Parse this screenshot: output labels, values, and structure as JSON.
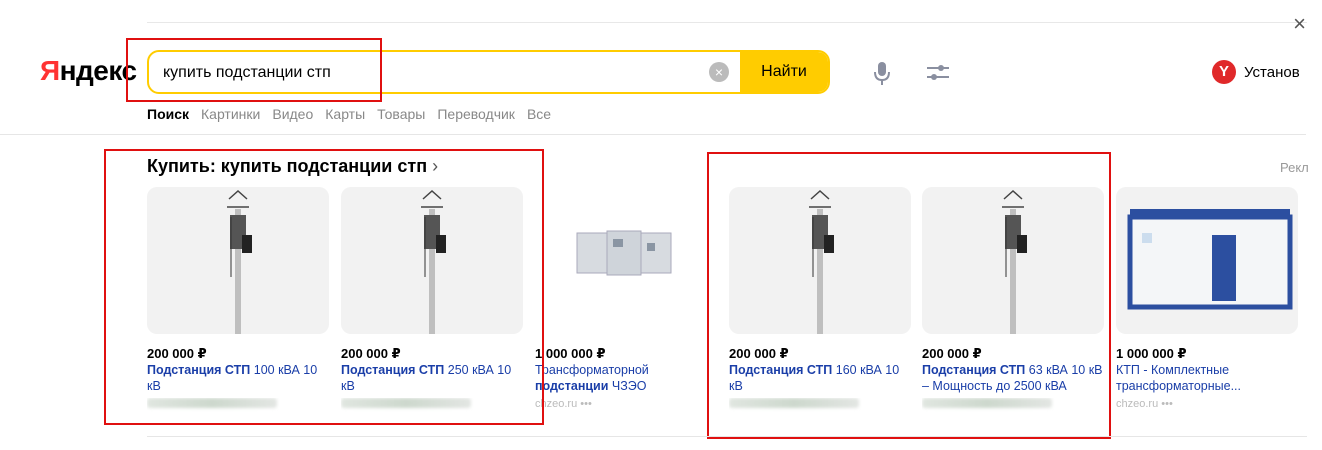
{
  "window": {
    "close_glyph": "×"
  },
  "logo": {
    "first_letter": "Я",
    "rest": "ндекс"
  },
  "search": {
    "query": "купить подстанции стп",
    "find_label": "Найти",
    "clear_glyph": "×"
  },
  "install": {
    "badge": "Y",
    "label": "Установ"
  },
  "tabs": [
    "Поиск",
    "Картинки",
    "Видео",
    "Карты",
    "Товары",
    "Переводчик",
    "Все"
  ],
  "shopping": {
    "title": "Купить: купить подстанции стп",
    "chevron": "›",
    "ad_label": "Рекл"
  },
  "products": [
    {
      "price": "200 000 ₽",
      "title_bold": "Подстанция СТП",
      "title_rest": " 100 кВА 10 кВ",
      "shop": "",
      "image": "pole-substation-icon"
    },
    {
      "price": "200 000 ₽",
      "title_bold": "Подстанция СТП",
      "title_rest": " 250 кВА 10 кВ",
      "shop": "",
      "image": "pole-substation-icon"
    },
    {
      "price": "1 000 000 ₽",
      "title_pre": "Трансформаторной ",
      "title_bold": "подстанции",
      "title_rest": " ЧЗЭО",
      "shop": "chzeo.ru •••",
      "image": "switchgear-icon"
    },
    {
      "price": "200 000 ₽",
      "title_bold": "Подстанция СТП",
      "title_rest": " 160 кВА 10 кВ",
      "shop": "",
      "image": "pole-substation-icon"
    },
    {
      "price": "200 000 ₽",
      "title_bold": "Подстанция СТП",
      "title_rest": " 63 кВА 10 кВ – Мощность до 2500 кВА",
      "shop": "",
      "image": "pole-substation-icon"
    },
    {
      "price": "1 000 000 ₽",
      "title_pre": "КТП - Комплектные трансформаторные...",
      "title_bold": "",
      "title_rest": "",
      "shop": "chzeo.ru •••",
      "image": "ktp-container-icon"
    }
  ],
  "colors": {
    "accent": "#ffcc00",
    "link": "#1a3ea8",
    "highlight_box": "#e01010",
    "logo_red": "#ff3333"
  }
}
